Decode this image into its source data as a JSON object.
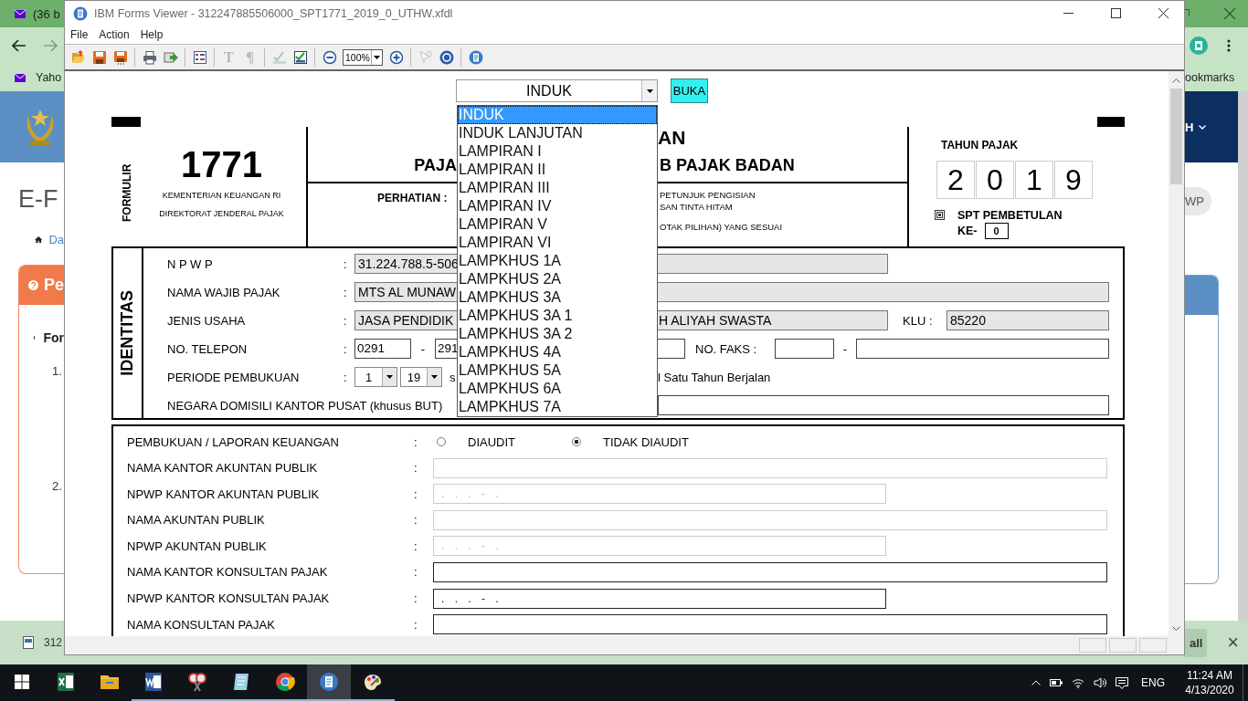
{
  "browser": {
    "tab_title": "(36 b",
    "bookmark": "Yaho",
    "bookmarks_label": "ookmarks",
    "page_title": "E-F",
    "breadcrumb": "Da",
    "panel_title": "Pe",
    "list_item": "For",
    "steps": [
      "1.",
      "2."
    ],
    "nav_menu": "H",
    "pill": "WP",
    "download": {
      "file": "312",
      "show_all": "all",
      "close": "×"
    }
  },
  "viewer": {
    "title": "IBM Forms Viewer - 312247885506000_SPT1771_2019_0_UTHW.xfdl",
    "menu": [
      "File",
      "Action",
      "Help"
    ],
    "toolbar": [
      {
        "kind": "button",
        "disabled": false
      },
      {
        "kind": "button",
        "disabled": false
      },
      {
        "kind": "button",
        "disabled": false
      },
      {
        "kind": "separator"
      },
      {
        "kind": "button",
        "disabled": false
      },
      {
        "kind": "button",
        "disabled": false
      },
      {
        "kind": "separator"
      },
      {
        "kind": "button",
        "disabled": false
      },
      {
        "kind": "separator"
      },
      {
        "kind": "glyph",
        "text": "T",
        "disabled": true
      },
      {
        "kind": "glyph",
        "text": "¶",
        "disabled": true
      },
      {
        "kind": "separator"
      },
      {
        "kind": "button",
        "disabled": true
      },
      {
        "kind": "button",
        "disabled": false
      },
      {
        "kind": "separator"
      },
      {
        "kind": "button",
        "disabled": false
      },
      {
        "kind": "zoom",
        "value": "100%"
      },
      {
        "kind": "button",
        "disabled": false
      },
      {
        "kind": "separator"
      },
      {
        "kind": "button",
        "disabled": true
      },
      {
        "kind": "button",
        "disabled": false
      },
      {
        "kind": "separator"
      },
      {
        "kind": "button",
        "disabled": false
      }
    ]
  },
  "form": {
    "doc_select": {
      "value": "INDUK",
      "expanded": true,
      "options": [
        {
          "label": "INDUK",
          "selected": true
        },
        {
          "label": "INDUK LANJUTAN",
          "selected": false
        },
        {
          "label": "LAMPIRAN I",
          "selected": false
        },
        {
          "label": "LAMPIRAN II",
          "selected": false
        },
        {
          "label": "LAMPIRAN III",
          "selected": false
        },
        {
          "label": "LAMPIRAN IV",
          "selected": false
        },
        {
          "label": "LAMPIRAN V",
          "selected": false
        },
        {
          "label": "LAMPIRAN VI",
          "selected": false
        },
        {
          "label": "LAMPKHUS 1A",
          "selected": false
        },
        {
          "label": "LAMPKHUS 2A",
          "selected": false
        },
        {
          "label": "LAMPKHUS 3A",
          "selected": false
        },
        {
          "label": "LAMPKHUS 3A 1",
          "selected": false
        },
        {
          "label": "LAMPKHUS 3A 2",
          "selected": false
        },
        {
          "label": "LAMPKHUS 4A",
          "selected": false
        },
        {
          "label": "LAMPKHUS 5A",
          "selected": false
        },
        {
          "label": "LAMPKHUS 6A",
          "selected": false
        },
        {
          "label": "LAMPKHUS 7A",
          "selected": false
        }
      ]
    },
    "open_button": "BUKA",
    "header": {
      "form_label": "FORMULIR",
      "form_number": "1771",
      "ministry": "KEMENTERIAN KEUANGAN RI",
      "directorate": "DIREKTORAT JENDERAL PAJAK",
      "title_1_right": "AN",
      "title_2_left": "PAJA",
      "title_2_right": "B PAJAK BADAN",
      "notice_label": "PERHATIAN :",
      "notice_lines": [
        "PETUNJUK PENGISIAN",
        "SAN TINTA HITAM",
        "OTAK PILIHAN) YANG SESUAI"
      ],
      "year_label": "TAHUN PAJAK",
      "year_digits": [
        "2",
        "0",
        "1",
        "9"
      ],
      "amendment_label": "SPT PEMBETULAN",
      "amendment_count_label": "KE-",
      "amendment_count": "0"
    },
    "identity": {
      "label": "IDENTITAS",
      "rows": [
        {
          "label": "N P W P",
          "colon": ":",
          "parts": [
            {
              "kind": "field",
              "readonly": true,
              "value": "31.224.788.5-506"
            }
          ]
        },
        {
          "label": "NAMA WAJIB PAJAK",
          "colon": ":",
          "parts": [
            {
              "kind": "field",
              "readonly": true,
              "value": "MTS AL MUNAW"
            }
          ]
        },
        {
          "label": "JENIS USAHA",
          "colon": ":",
          "parts": [
            {
              "kind": "field",
              "readonly": true,
              "value": "JASA PENDIDIK",
              "value_after": "H ALIYAH SWASTA"
            },
            {
              "kind": "text",
              "text": "KLU :"
            },
            {
              "kind": "field",
              "readonly": true,
              "value": "85220"
            }
          ]
        },
        {
          "label": "NO. TELEPON",
          "colon": ":",
          "parts": [
            {
              "kind": "field",
              "readonly": false,
              "value": "0291"
            },
            {
              "kind": "text",
              "text": "-"
            },
            {
              "kind": "field",
              "readonly": false,
              "value": "291"
            },
            {
              "kind": "text",
              "text": "NO. FAKS :"
            },
            {
              "kind": "field",
              "readonly": false
            },
            {
              "kind": "text",
              "text": "-"
            },
            {
              "kind": "field",
              "readonly": false
            }
          ]
        },
        {
          "label": "PERIODE PEMBUKUAN",
          "colon": ":",
          "parts": [
            {
              "kind": "select",
              "value": "1"
            },
            {
              "kind": "select",
              "value": "19"
            },
            {
              "kind": "text",
              "text": "s"
            },
            {
              "kind": "text",
              "text": "l Satu Tahun Berjalan"
            }
          ]
        },
        {
          "label": "NEGARA DOMISILI KANTOR PUSAT (khusus BUT)",
          "parts": [
            {
              "kind": "field",
              "readonly": false
            }
          ]
        }
      ]
    },
    "reporting": {
      "rows": [
        {
          "label": "PEMBUKUAN / LAPORAN KEUANGAN",
          "colon": ":",
          "kind": "radio",
          "options": [
            {
              "label": "DIAUDIT",
              "selected": false
            },
            {
              "label": "TIDAK DIAUDIT",
              "selected": true
            }
          ]
        },
        {
          "label": "NAMA KANTOR AKUNTAN PUBLIK",
          "colon": ":",
          "kind": "text",
          "disabled": true
        },
        {
          "label": "NPWP KANTOR AKUNTAN PUBLIK",
          "colon": ":",
          "kind": "npwp",
          "disabled": true,
          "value": ". . . - ."
        },
        {
          "label": "NAMA AKUNTAN PUBLIK",
          "colon": ":",
          "kind": "text",
          "disabled": true
        },
        {
          "label": "NPWP AKUNTAN PUBLIK",
          "colon": ":",
          "kind": "npwp",
          "disabled": true,
          "value": ". . . - ."
        },
        {
          "label": "NAMA KANTOR KONSULTAN PAJAK",
          "colon": ":",
          "kind": "text",
          "disabled": false
        },
        {
          "label": "NPWP KANTOR KONSULTAN PAJAK",
          "colon": ":",
          "kind": "npwp",
          "disabled": false,
          "value": ". . . - ."
        },
        {
          "label": "NAMA KONSULTAN PAJAK",
          "colon": ":",
          "kind": "text",
          "disabled": false
        }
      ]
    }
  },
  "taskbar": {
    "apps": [
      {
        "running": false,
        "selected": false
      },
      {
        "running": false,
        "selected": false
      },
      {
        "running": true,
        "selected": false
      },
      {
        "running": true,
        "selected": false
      },
      {
        "running": true,
        "selected": false
      },
      {
        "running": true,
        "selected": false
      },
      {
        "running": true,
        "selected": true
      },
      {
        "running": true,
        "selected": false
      }
    ],
    "language": "ENG",
    "time": "11:24 AM",
    "date": "4/13/2020"
  }
}
